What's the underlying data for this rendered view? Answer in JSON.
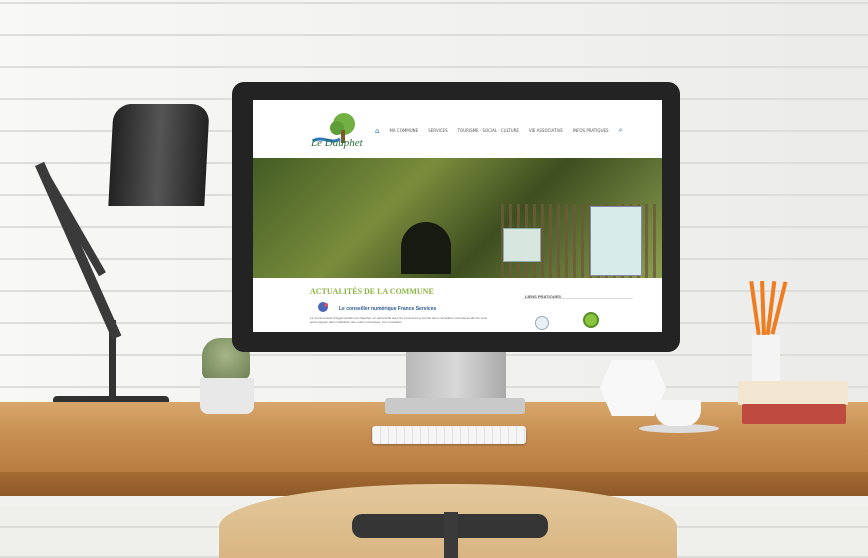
{
  "site": {
    "logo_text": "Le Dauphet",
    "nav_items": [
      "MA COMMUNE",
      "SERVICES",
      "TOURISME · SOCIAL · CULTURE",
      "VIE ASSOCIATIVE",
      "INFOS PRATIQUES"
    ],
    "section_title": "ACTUALITÉS DE LA COMMUNE",
    "article_title": "Le conseiller numérique France Services",
    "article_excerpt": "La Communauté d'Agglomération du Dauphet, en partenariat avec les communes a recruté deux conseillers numériques afin de vous accompagner dans l'utilisation des outils numériques. Vos conseillers",
    "sidebar_title": "LIENS PRATIQUES"
  }
}
